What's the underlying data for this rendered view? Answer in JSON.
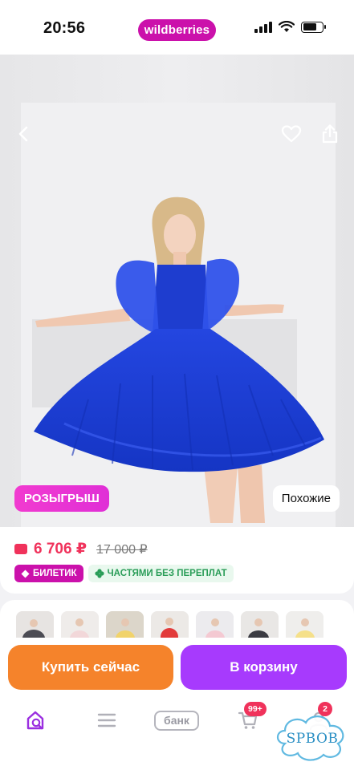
{
  "status_bar": {
    "time": "20:56",
    "brand": "wildberries"
  },
  "photo": {
    "raffle_badge": "РОЗЫГРЫШ",
    "similar_label": "Похожие"
  },
  "price": {
    "current": "6 706 ₽",
    "old": "17 000 ₽"
  },
  "tags": [
    {
      "label": "БИЛЕТИК"
    },
    {
      "label": "ЧАСТЯМИ БЕЗ ПЕРЕПЛАТ"
    }
  ],
  "actions": {
    "buy_now": "Купить сейчас",
    "add_to_cart": "В корзину"
  },
  "nav": {
    "bank_label": "банк",
    "cart_count": "99+",
    "profile_count": "2"
  },
  "watermark": {
    "text": "SPBOB"
  },
  "colors": {
    "brand": "#cb11ab",
    "price": "#f0325b",
    "buy_button": "#f5832b",
    "cart_button": "#a73afd",
    "dress": "#1d3fd8"
  }
}
